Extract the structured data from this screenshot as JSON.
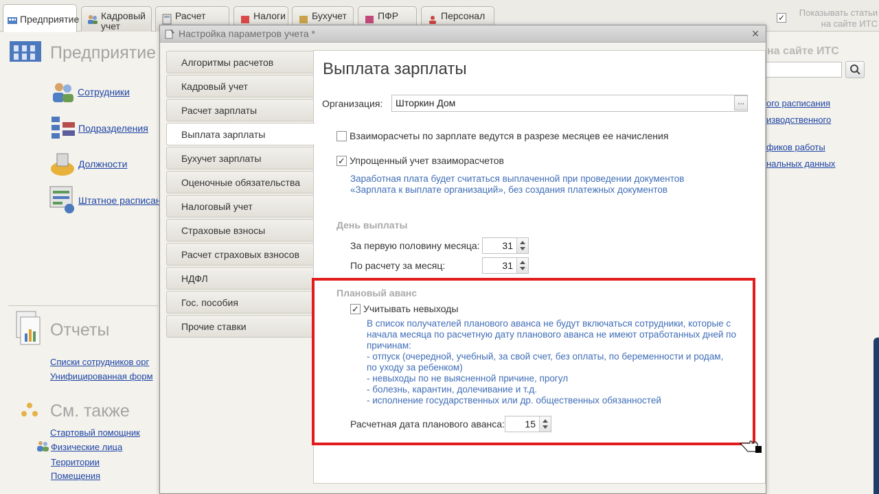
{
  "top_tabs": [
    {
      "label": "Предприятие",
      "icon": "enterprise-icon"
    },
    {
      "label": "Кадровый учет",
      "icon": "personnel-icon"
    },
    {
      "label": "Расчет",
      "icon": "calc-icon"
    },
    {
      "label": "Налоги",
      "icon": "taxes-icon"
    },
    {
      "label": "Бухучет",
      "icon": "accounting-icon"
    },
    {
      "label": "ПФР",
      "icon": "pfr-icon"
    },
    {
      "label": "Персонал",
      "icon": "staff-icon"
    }
  ],
  "its": {
    "checked": true,
    "label_line1": "Показывать статьи",
    "label_line2": "на сайте ИТС"
  },
  "left": {
    "enterprise_title": "Предприятие",
    "links": [
      "Сотрудники",
      "Подразделения",
      "Должности",
      "Штатное расписан"
    ],
    "reports_title": "Отчеты",
    "report_links": [
      "Списки сотрудников орг",
      "Унифицированная форм"
    ],
    "see_also_title": "См. также",
    "see_also_links": [
      "Стартовый помощник",
      "Физические лица",
      "Территории",
      "Помещения"
    ]
  },
  "right": {
    "title": "на сайте ИТС",
    "links": [
      "ого расписания",
      "изводственного",
      "фиков работы",
      "нальных данных"
    ]
  },
  "dialog": {
    "title": "Настройка параметров учета *",
    "close": "×",
    "tabs": [
      "Алгоритмы расчетов",
      "Кадровый учет",
      "Расчет зарплаты",
      "Выплата зарплаты",
      "Бухучет зарплаты",
      "Оценочные обязательства",
      "Налоговый учет",
      "Страховые взносы",
      "Расчет страховых взносов",
      "НДФЛ",
      "Гос. пособия",
      "Прочие ставки"
    ],
    "active_tab": "Выплата зарплаты",
    "page_title": "Выплата зарплаты",
    "org_label": "Организация:",
    "org_value": "Шторкин Дом",
    "dots": "...",
    "cb1_label": "Взаиморасчеты по зарплате ведутся в разрезе месяцев ее начисления",
    "cb1_checked": false,
    "cb2_label": "Упрощенный учет взаиморасчетов",
    "cb2_checked": true,
    "cb2_hint_line1": "Заработная плата будет считаться выплаченной при проведении документов",
    "cb2_hint_line2": "«Зарплата к выплате организаций», без создания платежных документов",
    "payday_header": "День выплаты",
    "first_half_label": "За первую половину месяца:",
    "first_half_value": "31",
    "monthly_label": "По расчету за месяц:",
    "monthly_value": "31",
    "advance_header": "Плановый аванс",
    "absence_label": "Учитывать невыходы",
    "absence_checked": true,
    "advance_hint": [
      "В список получателей планового аванса не будут включаться сотрудники, которые с",
      "начала месяца по расчетную дату планового аванса не имеют отработанных дней по",
      "причинам:",
      "- отпуск (очередной, учебный, за свой счет, без оплаты, по беременности и родам,",
      "по уходу за ребенком)",
      "- невыходы по не выясненной причине, прогул",
      "- болезнь, карантин, долечивание и т.д.",
      "- исполнение государственных или др. общественных обязанностей"
    ],
    "advance_date_label": "Расчетная дата планового аванса:",
    "advance_date_value": "15"
  },
  "colors": {
    "highlight": "#e21b1b",
    "link": "#1d44a6",
    "hint": "#3f6db6"
  }
}
